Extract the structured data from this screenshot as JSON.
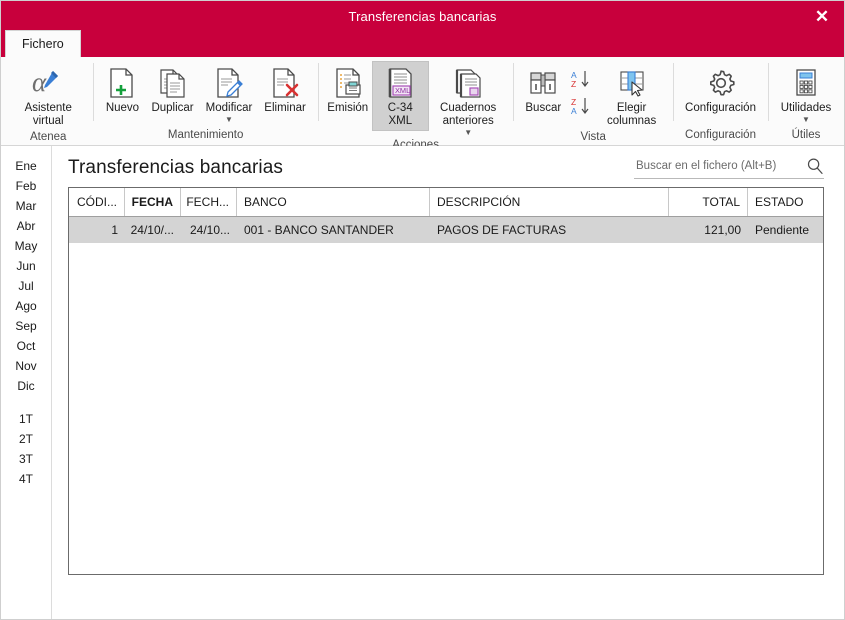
{
  "window": {
    "title": "Transferencias bancarias",
    "close_label": "✕",
    "close_icon": "close-icon",
    "accent_color": "#C8003C"
  },
  "tabs": [
    {
      "label": "Fichero",
      "active": true
    }
  ],
  "ribbon": {
    "groups": [
      {
        "label": "Atenea",
        "buttons": [
          {
            "label": "Asistente virtual",
            "icon": "alpha-pen-icon",
            "caret": false,
            "selected": false
          }
        ]
      },
      {
        "label": "Mantenimiento",
        "buttons": [
          {
            "label": "Nuevo",
            "icon": "new-document-icon",
            "caret": false,
            "selected": false
          },
          {
            "label": "Duplicar",
            "icon": "duplicate-document-icon",
            "caret": false,
            "selected": false
          },
          {
            "label": "Modificar",
            "icon": "edit-document-icon",
            "caret": true,
            "selected": false
          },
          {
            "label": "Eliminar",
            "icon": "delete-document-icon",
            "caret": false,
            "selected": false
          }
        ]
      },
      {
        "label": "Acciones",
        "buttons": [
          {
            "label": "Emisión",
            "icon": "print-document-icon",
            "caret": false,
            "selected": false
          },
          {
            "label": "C-34 XML",
            "icon": "xml-document-icon",
            "caret": false,
            "selected": true
          },
          {
            "label": "Cuadernos anteriores",
            "icon": "previous-books-icon",
            "caret": true,
            "selected": false
          }
        ]
      },
      {
        "label": "Vista",
        "buttons": [
          {
            "label": "Buscar",
            "icon": "binoculars-icon",
            "caret": false,
            "selected": false
          },
          {
            "label": "Elegir columnas",
            "icon": "choose-columns-icon",
            "caret": false,
            "selected": false
          }
        ],
        "sort_buttons": [
          {
            "icon": "sort-ascending-icon",
            "label": "A↓Z"
          },
          {
            "icon": "sort-descending-icon",
            "label": "Z↓A"
          }
        ]
      },
      {
        "label": "Configuración",
        "buttons": [
          {
            "label": "Configuración",
            "icon": "gear-icon",
            "caret": false,
            "selected": false
          }
        ]
      },
      {
        "label": "Útiles",
        "buttons": [
          {
            "label": "Utilidades",
            "icon": "calculator-icon",
            "caret": true,
            "selected": false
          }
        ]
      }
    ]
  },
  "sidebar": {
    "months": [
      "Ene",
      "Feb",
      "Mar",
      "Abr",
      "May",
      "Jun",
      "Jul",
      "Ago",
      "Sep",
      "Oct",
      "Nov",
      "Dic"
    ],
    "quarters": [
      "1T",
      "2T",
      "3T",
      "4T"
    ]
  },
  "main": {
    "page_title": "Transferencias bancarias",
    "search": {
      "placeholder": "Buscar en el fichero (Alt+B)",
      "value": "",
      "icon": "search-icon"
    },
    "table": {
      "columns": [
        {
          "key": "codigo",
          "label": "CÓDI...",
          "align": "right",
          "sorted": false
        },
        {
          "key": "fecha",
          "label": "FECHA",
          "align": "right",
          "sorted": true
        },
        {
          "key": "fecha2",
          "label": "FECH...",
          "align": "right",
          "sorted": false
        },
        {
          "key": "banco",
          "label": "BANCO",
          "align": "left",
          "sorted": false
        },
        {
          "key": "descripcion",
          "label": "DESCRIPCIÓN",
          "align": "left",
          "sorted": false
        },
        {
          "key": "total",
          "label": "TOTAL",
          "align": "right",
          "sorted": false
        },
        {
          "key": "estado",
          "label": "ESTADO",
          "align": "left",
          "sorted": false
        }
      ],
      "rows": [
        {
          "codigo": "1",
          "fecha": "24/10/...",
          "fecha2": "24/10...",
          "banco": "001 - BANCO SANTANDER",
          "descripcion": "PAGOS DE FACTURAS",
          "total": "121,00",
          "estado": "Pendiente",
          "selected": true
        }
      ]
    }
  }
}
